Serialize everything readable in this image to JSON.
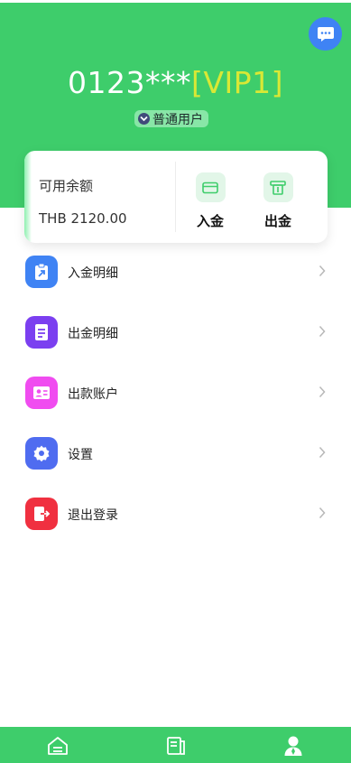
{
  "header": {
    "account": "0123***",
    "vip": "[VIP1]",
    "user_type": "普通用户"
  },
  "balance": {
    "label": "可用余额",
    "value": "THB 2120.00",
    "deposit_label": "入金",
    "withdraw_label": "出金"
  },
  "menu": [
    {
      "label": "入金明细",
      "icon": "deposit-record-icon",
      "color": "#3f83f4"
    },
    {
      "label": "出金明细",
      "icon": "withdraw-record-icon",
      "color": "#7b3ff0"
    },
    {
      "label": "出款账户",
      "icon": "payout-account-icon",
      "color": "#f04cf0"
    },
    {
      "label": "设置",
      "icon": "settings-gear-icon",
      "color": "#4f6cf0"
    },
    {
      "label": "退出登录",
      "icon": "logout-icon",
      "color": "#f03040"
    }
  ],
  "tabbar": {
    "tabs": [
      "home-icon",
      "records-icon",
      "profile-icon"
    ],
    "active": "profile-icon"
  },
  "colors": {
    "primary_green": "#3ecd6b",
    "vip_yellow": "#d9e835",
    "chat_blue": "#3f83f4"
  }
}
